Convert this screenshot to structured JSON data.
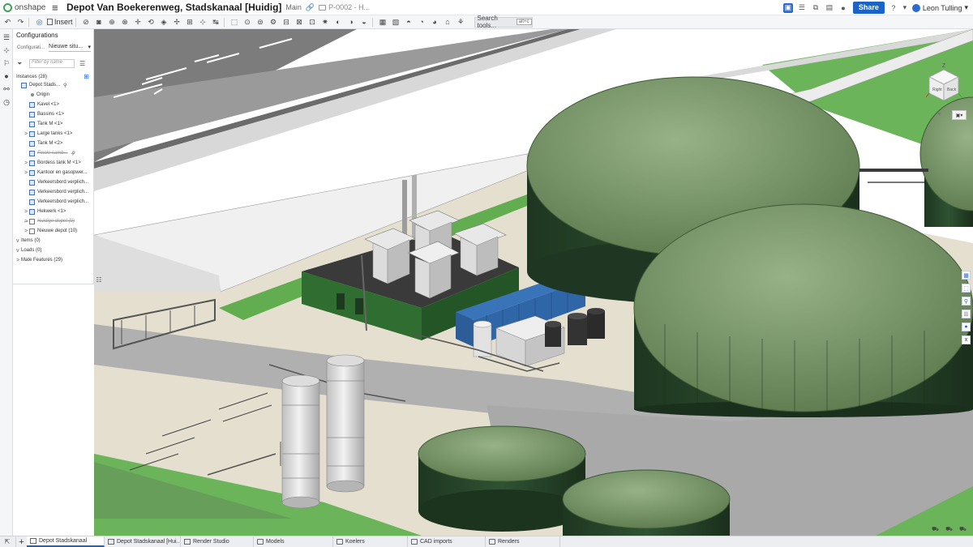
{
  "header": {
    "brand": "onshape",
    "document_title": "Depot Van Boekerenweg, Stadskanaal [Huidig]",
    "branch": "Main",
    "part_number": "P-0002 - H...",
    "share_label": "Share",
    "help_label": "?",
    "user_name": "Leon Tulling"
  },
  "toolbar": {
    "insert_label": "Insert",
    "search_tools_label": "Search tools...",
    "search_shortcut": "alt+c"
  },
  "panel": {
    "configurations_title": "Configurations",
    "config_label": "Configurati...",
    "config_value": "Nieuwe situ...",
    "filter_placeholder": "Filter by name",
    "instances_header": "Instances (28)",
    "tree": [
      {
        "label": "Depot Stads...",
        "indent": 0,
        "icon": "assembly",
        "expand": "",
        "struck": false,
        "pin": true
      },
      {
        "label": "Origin",
        "indent": 1,
        "icon": "origin",
        "expand": "",
        "struck": false,
        "pin": false
      },
      {
        "label": "Kavel <1>",
        "indent": 1,
        "icon": "part",
        "expand": "",
        "struck": false,
        "pin": false
      },
      {
        "label": "Bassins <1>",
        "indent": 1,
        "icon": "part",
        "expand": "",
        "struck": false,
        "pin": false
      },
      {
        "label": "Tank M <1>",
        "indent": 1,
        "icon": "part",
        "expand": "",
        "struck": false,
        "pin": false
      },
      {
        "label": "Large tanks <1>",
        "indent": 1,
        "icon": "part",
        "expand": ">",
        "struck": false,
        "pin": false
      },
      {
        "label": "Tank M <2>",
        "indent": 1,
        "icon": "part",
        "expand": "",
        "struck": false,
        "pin": false
      },
      {
        "label": "Finale samb...",
        "indent": 1,
        "icon": "part",
        "expand": "",
        "struck": true,
        "pin": true
      },
      {
        "label": "Bordess tank M <1>",
        "indent": 1,
        "icon": "part",
        "expand": ">",
        "struck": false,
        "pin": false
      },
      {
        "label": "Kantoor en gasopwer...",
        "indent": 1,
        "icon": "part",
        "expand": ">",
        "struck": false,
        "pin": false
      },
      {
        "label": "Verkeersbord verplich...",
        "indent": 1,
        "icon": "part",
        "expand": "",
        "struck": false,
        "pin": false
      },
      {
        "label": "Verkeersbord verplich...",
        "indent": 1,
        "icon": "part",
        "expand": "",
        "struck": false,
        "pin": false
      },
      {
        "label": "Verkeersbord verplich...",
        "indent": 1,
        "icon": "part",
        "expand": "",
        "struck": false,
        "pin": false
      },
      {
        "label": "Hekwerk <1>",
        "indent": 1,
        "icon": "part",
        "expand": ">",
        "struck": false,
        "pin": false
      },
      {
        "label": "Huidige depot (0)",
        "indent": 1,
        "icon": "folder",
        "expand": ">",
        "struck": true,
        "pin": false
      },
      {
        "label": "Nieuwe depot (10)",
        "indent": 1,
        "icon": "folder",
        "expand": ">",
        "struck": false,
        "pin": false
      },
      {
        "label": "Items (0)",
        "indent": 0,
        "icon": "none",
        "expand": "v",
        "struck": false,
        "pin": false
      },
      {
        "label": "Loads (0)",
        "indent": 0,
        "icon": "none",
        "expand": "v",
        "struck": false,
        "pin": false
      },
      {
        "label": "Mate Features (29)",
        "indent": 0,
        "icon": "none",
        "expand": ">",
        "struck": false,
        "pin": false
      }
    ]
  },
  "viewcube": {
    "axis_label": "Z",
    "face_right": "Right",
    "face_back": "Back"
  },
  "tabs": [
    {
      "label": "Depot Stadskanaal",
      "type": "assembly",
      "active": true
    },
    {
      "label": "Depot Stadskanaal [Hui...",
      "type": "drawing",
      "active": false
    },
    {
      "label": "Render Studio",
      "type": "render",
      "active": false
    },
    {
      "label": "Models",
      "type": "folder",
      "active": false
    },
    {
      "label": "Koelers",
      "type": "folder",
      "active": false
    },
    {
      "label": "CAD imports",
      "type": "folder",
      "active": false
    },
    {
      "label": "Renders",
      "type": "folder",
      "active": false
    }
  ],
  "colors": {
    "brand_blue": "#1b63c4",
    "onshape_green": "#3aa55a",
    "tank_roof": "#7d9a6c",
    "tank_wall": "#27432a",
    "grass": "#5ea84c",
    "pavement": "#e3ddcd",
    "road": "#a7a7a7"
  }
}
